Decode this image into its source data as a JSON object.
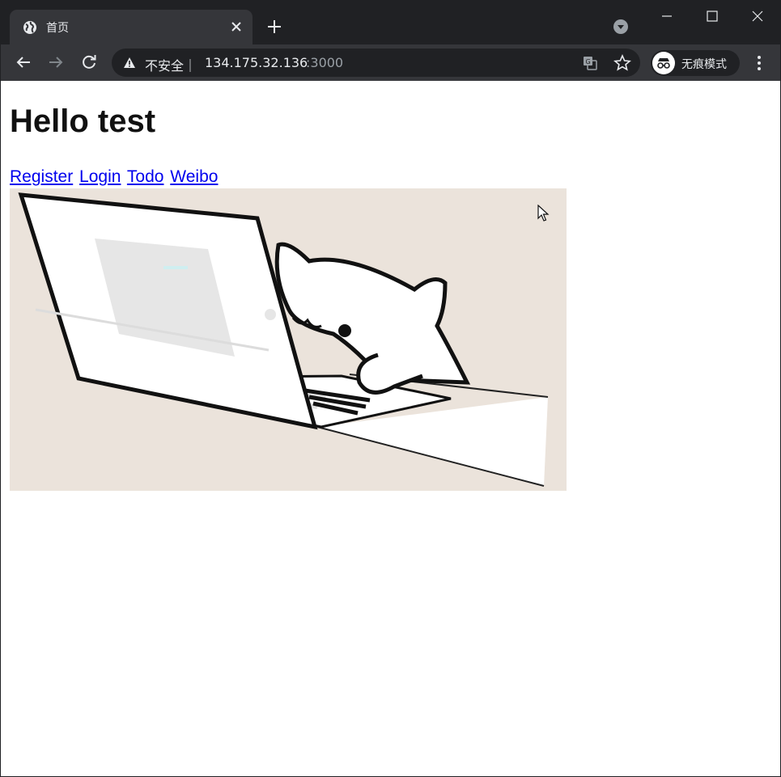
{
  "browser": {
    "tab": {
      "title": "首页",
      "favicon": "globe-icon"
    },
    "toolbar": {
      "security_label": "不安全｜",
      "url_host": "134.175.32.136",
      "url_port": ":3000",
      "profile_label": "无痕模式"
    },
    "colors": {
      "frame": "#202124",
      "toolbar": "#35363a",
      "text": "#e8eaed",
      "dim_text": "#9aa0a6"
    }
  },
  "page": {
    "heading": "Hello test",
    "links": [
      {
        "label": "Register"
      },
      {
        "label": "Login"
      },
      {
        "label": "Todo"
      },
      {
        "label": "Weibo"
      }
    ],
    "image": {
      "subject": "cartoon cat typing on a laptop",
      "background_color": "#ebe3db"
    },
    "link_color": "#0000ee"
  }
}
